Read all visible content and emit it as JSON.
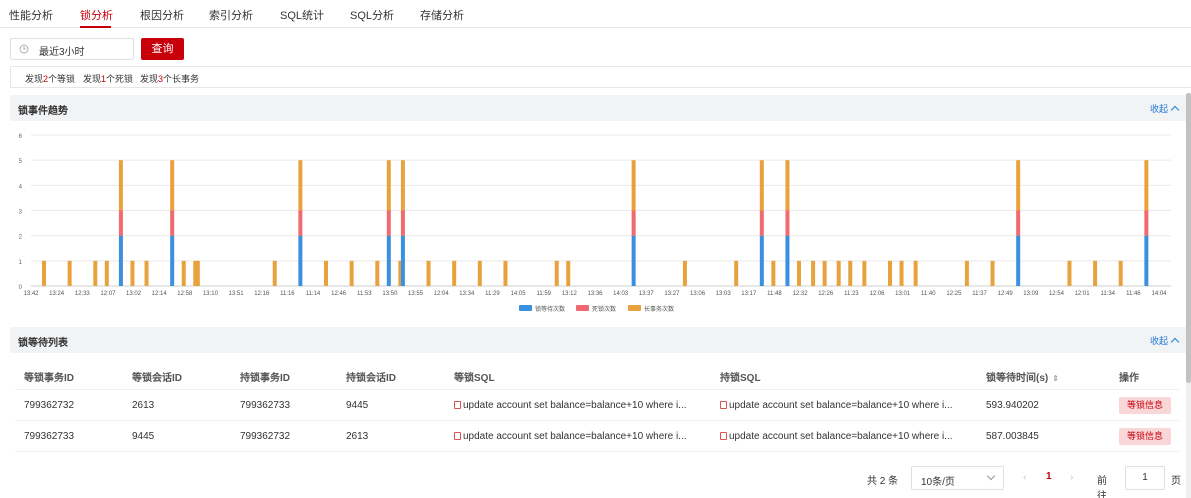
{
  "tabs": [
    "性能分析",
    "锁分析",
    "根因分析",
    "索引分析",
    "SQL统计",
    "SQL分析",
    "存储分析"
  ],
  "active_tab": "锁分析",
  "filter": {
    "time_range": "最近3小时",
    "query_label": "查询"
  },
  "summary": {
    "s1_pre": "发现",
    "s1_num": "2",
    "s1_post": "个等锁",
    "s2_pre": "发现",
    "s2_num": "1",
    "s2_post": "个死锁",
    "s3_pre": "发现",
    "s3_num": "3",
    "s3_post": "个长事务"
  },
  "lock_trend": {
    "title": "锁事件趋势",
    "collapse_label": "收起"
  },
  "chart_data": {
    "type": "bar",
    "stacked": true,
    "ylim": [
      0,
      6
    ],
    "yticks": [
      0,
      1,
      2,
      3,
      4,
      5,
      6
    ],
    "grid": true,
    "legend_position": "bottom",
    "x_tick_labels": [
      "13:42",
      "13:24",
      "12:33",
      "12:07",
      "13:02",
      "12:14",
      "12:58",
      "13:10",
      "13:51",
      "12:16",
      "11:16",
      "11:14",
      "12:46",
      "11:53",
      "13:50",
      "13:55",
      "12:04",
      "13:34",
      "11:29",
      "14:05",
      "11:59",
      "13:12",
      "13:36",
      "14:03",
      "13:37",
      "13:27",
      "13:06",
      "13:03",
      "13:17",
      "11:48",
      "12:32",
      "12:26",
      "11:23",
      "12:06",
      "13:01",
      "11:40",
      "12:25",
      "11:37",
      "12:49",
      "13:09",
      "12:54",
      "12:01",
      "11:34",
      "11:46",
      "14:04"
    ],
    "series": [
      {
        "name": "锁等待次数",
        "color": "#3b8fe0"
      },
      {
        "name": "死锁次数",
        "color": "#f06a6f"
      },
      {
        "name": "长事务次数",
        "color": "#e8a23d"
      }
    ],
    "bars": [
      {
        "x": "13:42",
        "values": [
          0,
          0,
          1
        ]
      },
      {
        "x": "13:24",
        "values": [
          0,
          0,
          1
        ]
      },
      {
        "x": "12:33",
        "values": [
          0,
          0,
          1
        ]
      },
      {
        "x": "12:33",
        "values": [
          0,
          0,
          1
        ]
      },
      {
        "x": "12:07",
        "values": [
          2,
          1,
          2
        ]
      },
      {
        "x": "12:07",
        "values": [
          0,
          0,
          1
        ]
      },
      {
        "x": "13:02",
        "values": [
          0,
          0,
          1
        ]
      },
      {
        "x": "12:14",
        "values": [
          2,
          1,
          2
        ]
      },
      {
        "x": "12:14",
        "values": [
          0,
          0,
          1
        ]
      },
      {
        "x": "12:14",
        "values": [
          0,
          0,
          1
        ]
      },
      {
        "x": "12:58",
        "values": [
          0,
          0,
          1
        ]
      },
      {
        "x": "12:16",
        "values": [
          0,
          0,
          1
        ]
      },
      {
        "x": "11:16",
        "values": [
          2,
          1,
          2
        ]
      },
      {
        "x": "11:14",
        "values": [
          0,
          0,
          1
        ]
      },
      {
        "x": "12:46",
        "values": [
          0,
          0,
          1
        ]
      },
      {
        "x": "11:53",
        "values": [
          0,
          0,
          1
        ]
      },
      {
        "x": "11:53",
        "values": [
          2,
          1,
          2
        ]
      },
      {
        "x": "11:53",
        "values": [
          0,
          0,
          1
        ]
      },
      {
        "x": "13:50",
        "values": [
          2,
          1,
          2
        ]
      },
      {
        "x": "13:55",
        "values": [
          0,
          0,
          1
        ]
      },
      {
        "x": "12:04",
        "values": [
          0,
          0,
          1
        ]
      },
      {
        "x": "13:34",
        "values": [
          0,
          0,
          1
        ]
      },
      {
        "x": "11:29",
        "values": [
          0,
          0,
          1
        ]
      },
      {
        "x": "11:59",
        "values": [
          0,
          0,
          1
        ]
      },
      {
        "x": "11:59",
        "values": [
          0,
          0,
          1
        ]
      },
      {
        "x": "14:03",
        "values": [
          2,
          1,
          2
        ]
      },
      {
        "x": "13:27",
        "values": [
          0,
          0,
          1
        ]
      },
      {
        "x": "13:03",
        "values": [
          0,
          0,
          1
        ]
      },
      {
        "x": "13:17",
        "values": [
          2,
          1,
          2
        ]
      },
      {
        "x": "13:17",
        "values": [
          0,
          0,
          1
        ]
      },
      {
        "x": "11:48",
        "values": [
          2,
          1,
          2
        ]
      },
      {
        "x": "11:48",
        "values": [
          0,
          0,
          1
        ]
      },
      {
        "x": "12:32",
        "values": [
          0,
          0,
          1
        ]
      },
      {
        "x": "12:32",
        "values": [
          0,
          0,
          1
        ]
      },
      {
        "x": "12:26",
        "values": [
          0,
          0,
          1
        ]
      },
      {
        "x": "12:26",
        "values": [
          0,
          0,
          1
        ]
      },
      {
        "x": "11:23",
        "values": [
          0,
          0,
          1
        ]
      },
      {
        "x": "12:06",
        "values": [
          0,
          0,
          1
        ]
      },
      {
        "x": "12:06",
        "values": [
          0,
          0,
          1
        ]
      },
      {
        "x": "13:01",
        "values": [
          0,
          0,
          1
        ]
      },
      {
        "x": "12:25",
        "values": [
          0,
          0,
          1
        ]
      },
      {
        "x": "11:37",
        "values": [
          0,
          0,
          1
        ]
      },
      {
        "x": "12:49",
        "values": [
          2,
          1,
          2
        ]
      },
      {
        "x": "12:54",
        "values": [
          0,
          0,
          1
        ]
      },
      {
        "x": "12:01",
        "values": [
          0,
          0,
          1
        ]
      },
      {
        "x": "11:34",
        "values": [
          0,
          0,
          1
        ]
      },
      {
        "x": "11:46",
        "values": [
          2,
          1,
          2
        ]
      }
    ]
  },
  "lock_wait": {
    "title": "锁等待列表",
    "collapse_label": "收起",
    "columns": [
      "等锁事务ID",
      "等锁会话ID",
      "持锁事务ID",
      "持锁会话ID",
      "等锁SQL",
      "持锁SQL",
      "锁等待时间(s)",
      "操作"
    ],
    "rows": [
      [
        "799362732",
        "2613",
        "799362733",
        "9445",
        "update account set balance=balance+10 where i...",
        "update account set balance=balance+10 where i...",
        "593.940202",
        "等锁信息"
      ],
      [
        "799362733",
        "9445",
        "799362732",
        "2613",
        "update account set balance=balance+10 where i...",
        "update account set balance=balance+10 where i...",
        "587.003845",
        "等锁信息"
      ]
    ]
  },
  "pagination": {
    "total_text": "共 2 条",
    "page_size": "10条/页",
    "current_page": "1",
    "goto_label": "前往",
    "jump_value": "1",
    "page_unit": "页"
  }
}
